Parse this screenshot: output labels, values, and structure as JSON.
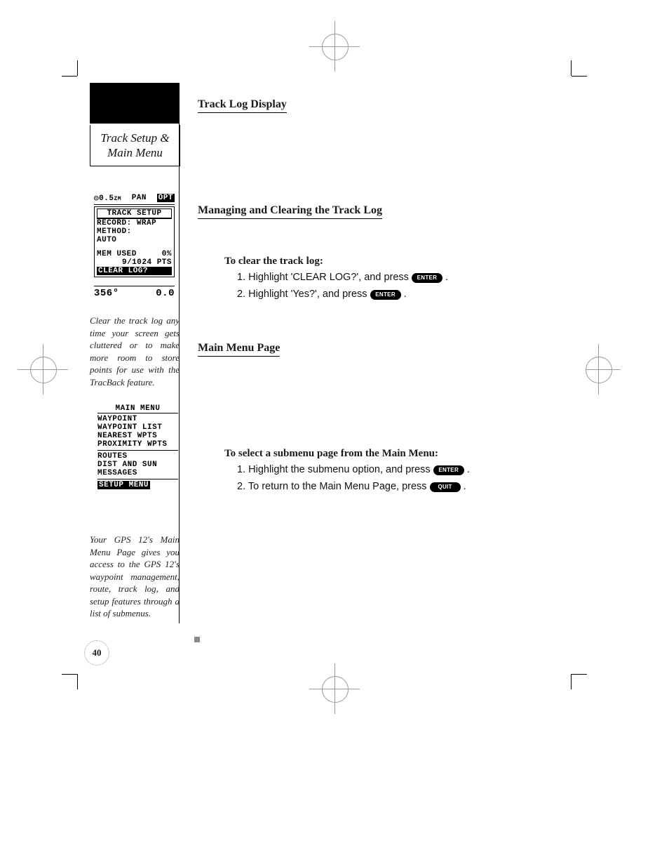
{
  "sidebar": {
    "title_line1": "Track Setup &",
    "title_line2": "Main Menu",
    "caption1": "Clear the track log any time your screen gets cluttered or to make more room to store points for use with the TracBack feature.",
    "caption2": "Your GPS 12's Main Menu Page gives you access to the GPS 12's waypoint management, route, track log, and setup features through a list of submenus."
  },
  "lcd1": {
    "top_left_icon": "◎",
    "top_scale": "0.5",
    "top_unit": "ZM",
    "top_mode": "PAN",
    "top_badge": "OPT",
    "box_title": "TRACK SETUP",
    "record_label": "RECORD:",
    "record_value": "WRAP",
    "method_label": "METHOD:",
    "method_value": "AUTO",
    "mem_label": "MEM USED",
    "mem_value": "0%",
    "pts_value": "9/1024 PTS",
    "clear": "CLEAR LOG?",
    "heading": "356°",
    "speed": "0.0"
  },
  "lcd2": {
    "title": "MAIN MENU",
    "items_a": [
      "WAYPOINT",
      "WAYPOINT LIST",
      "NEAREST WPTS",
      "PROXIMITY WPTS"
    ],
    "items_b": [
      "ROUTES",
      "DIST AND SUN",
      "MESSAGES"
    ],
    "setup": "SETUP MENU"
  },
  "main": {
    "h1": "Track Log Display",
    "h2": "Managing and Clearing the Track Log",
    "clear_title": "To clear the track log:",
    "clear_step1_a": "1. Highlight 'CLEAR LOG?', and press ",
    "clear_step2_a": "2. Highlight 'Yes?', and press ",
    "h3": "Main Menu Page",
    "select_title": "To select a submenu page from the Main Menu:",
    "select_step1_a": "1. Highlight the submenu option, and press ",
    "select_step2_a": "2. To return to the Main Menu Page, press ",
    "period": " ."
  },
  "buttons": {
    "enter": "ENTER",
    "quit": "QUIT"
  },
  "page_number": "40"
}
